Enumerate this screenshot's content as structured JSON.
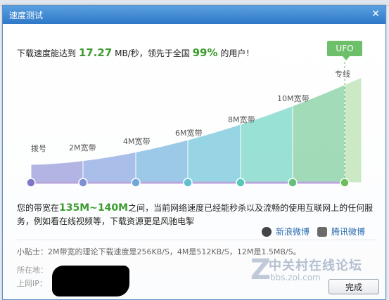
{
  "window": {
    "title": "速度测试",
    "close_glyph": "✕"
  },
  "headline": {
    "prefix": "下载速度能达到",
    "speed": "17.27",
    "unit": "MB/秒，领先于全国",
    "percent": "99%",
    "suffix": "的用户！"
  },
  "levels": [
    {
      "label": "拨号",
      "color": "#8fa9df"
    },
    {
      "label": "2M宽带",
      "color": "#8fa9df"
    },
    {
      "label": "4M宽带",
      "color": "#7fb5e0"
    },
    {
      "label": "6M宽带",
      "color": "#79c3db"
    },
    {
      "label": "8M宽带",
      "color": "#7ad2ce"
    },
    {
      "label": "10M宽带",
      "color": "#7ccaa6"
    },
    {
      "label": "专线",
      "color": "#8ed08c"
    }
  ],
  "ufo_badge": "UFO",
  "bandwidth": {
    "prefix": "您的带宽在",
    "range": "135M~140M",
    "text": "之间，当前网络速度已经能秒杀以及流畅的使用互联网上的任何服务，例如看在线视频等，下载资源更是风驰电掣"
  },
  "share": {
    "weibo": "新浪微博",
    "tencent": "腾讯微博"
  },
  "tip": "小贴士：2M带宽的理论下载速度是256KB/S，4M是512KB/S，12M是1.5MB/S。",
  "info": {
    "location_label": "所在地：",
    "ip_label": "上网IP："
  },
  "watermark": {
    "text": "中关村在线论坛",
    "url": "bbs.zol.com",
    "letter": "Z"
  },
  "ok_button": "完成"
}
